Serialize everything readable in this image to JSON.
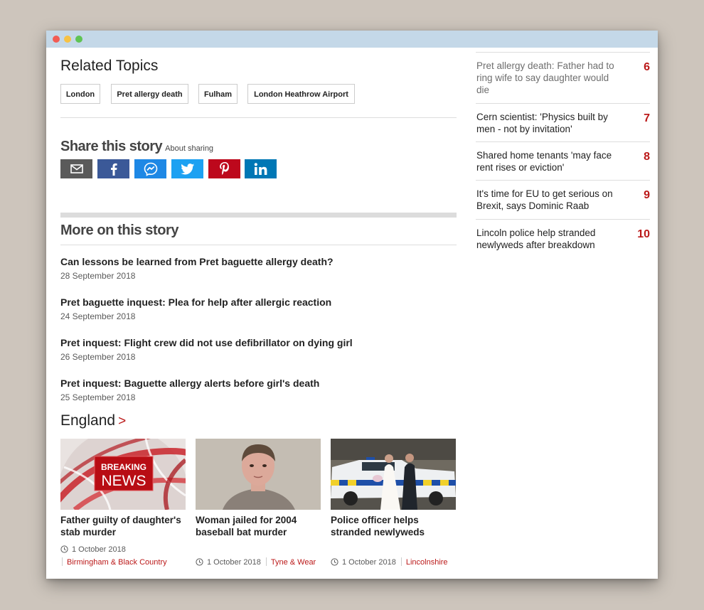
{
  "colors": {
    "accent": "#bb1919",
    "titlebar": "#c4d8e8"
  },
  "related": {
    "title": "Related Topics",
    "tags": [
      "London",
      "Pret allergy death",
      "Fulham",
      "London Heathrow Airport"
    ]
  },
  "share": {
    "title": "Share this story",
    "about": "About sharing",
    "buttons": [
      "email-icon",
      "facebook-icon",
      "messenger-icon",
      "twitter-icon",
      "pinterest-icon",
      "linkedin-icon"
    ]
  },
  "more": {
    "title": "More on this story",
    "stories": [
      {
        "title": "Can lessons be learned from Pret baguette allergy death?",
        "date": "28 September 2018"
      },
      {
        "title": "Pret baguette inquest: Plea for help after allergic reaction",
        "date": "24 September 2018"
      },
      {
        "title": "Pret inquest: Flight crew did not use defibrillator on dying girl",
        "date": "26 September 2018"
      },
      {
        "title": "Pret inquest: Baguette allergy alerts before girl's death",
        "date": "25 September 2018"
      }
    ]
  },
  "england": {
    "title": "England",
    "chevron": ">",
    "cards": [
      {
        "title": "Father guilty of daughter's stab murder",
        "date": "1 October 2018",
        "location": "Birmingham & Black Country",
        "image": "breaking-news-graphic",
        "badge_top": "BREAKING",
        "badge_bottom": "NEWS"
      },
      {
        "title": "Woman jailed for 2004 baseball bat murder",
        "date": "1 October 2018",
        "location": "Tyne & Wear",
        "image": "mugshot-photo"
      },
      {
        "title": "Police officer helps stranded newlyweds",
        "date": "1 October 2018",
        "location": "Lincolnshire",
        "image": "police-car-bride-photo"
      }
    ]
  },
  "most_read": [
    {
      "number": "6",
      "title": "Pret allergy death: Father had to ring wife to say daughter would die"
    },
    {
      "number": "7",
      "title": "Cern scientist: 'Physics built by men - not by invitation'"
    },
    {
      "number": "8",
      "title": "Shared home tenants 'may face rent rises or eviction'"
    },
    {
      "number": "9",
      "title": "It's time for EU to get serious on Brexit, says Dominic Raab"
    },
    {
      "number": "10",
      "title": "Lincoln police help stranded newlyweds after breakdown"
    }
  ]
}
